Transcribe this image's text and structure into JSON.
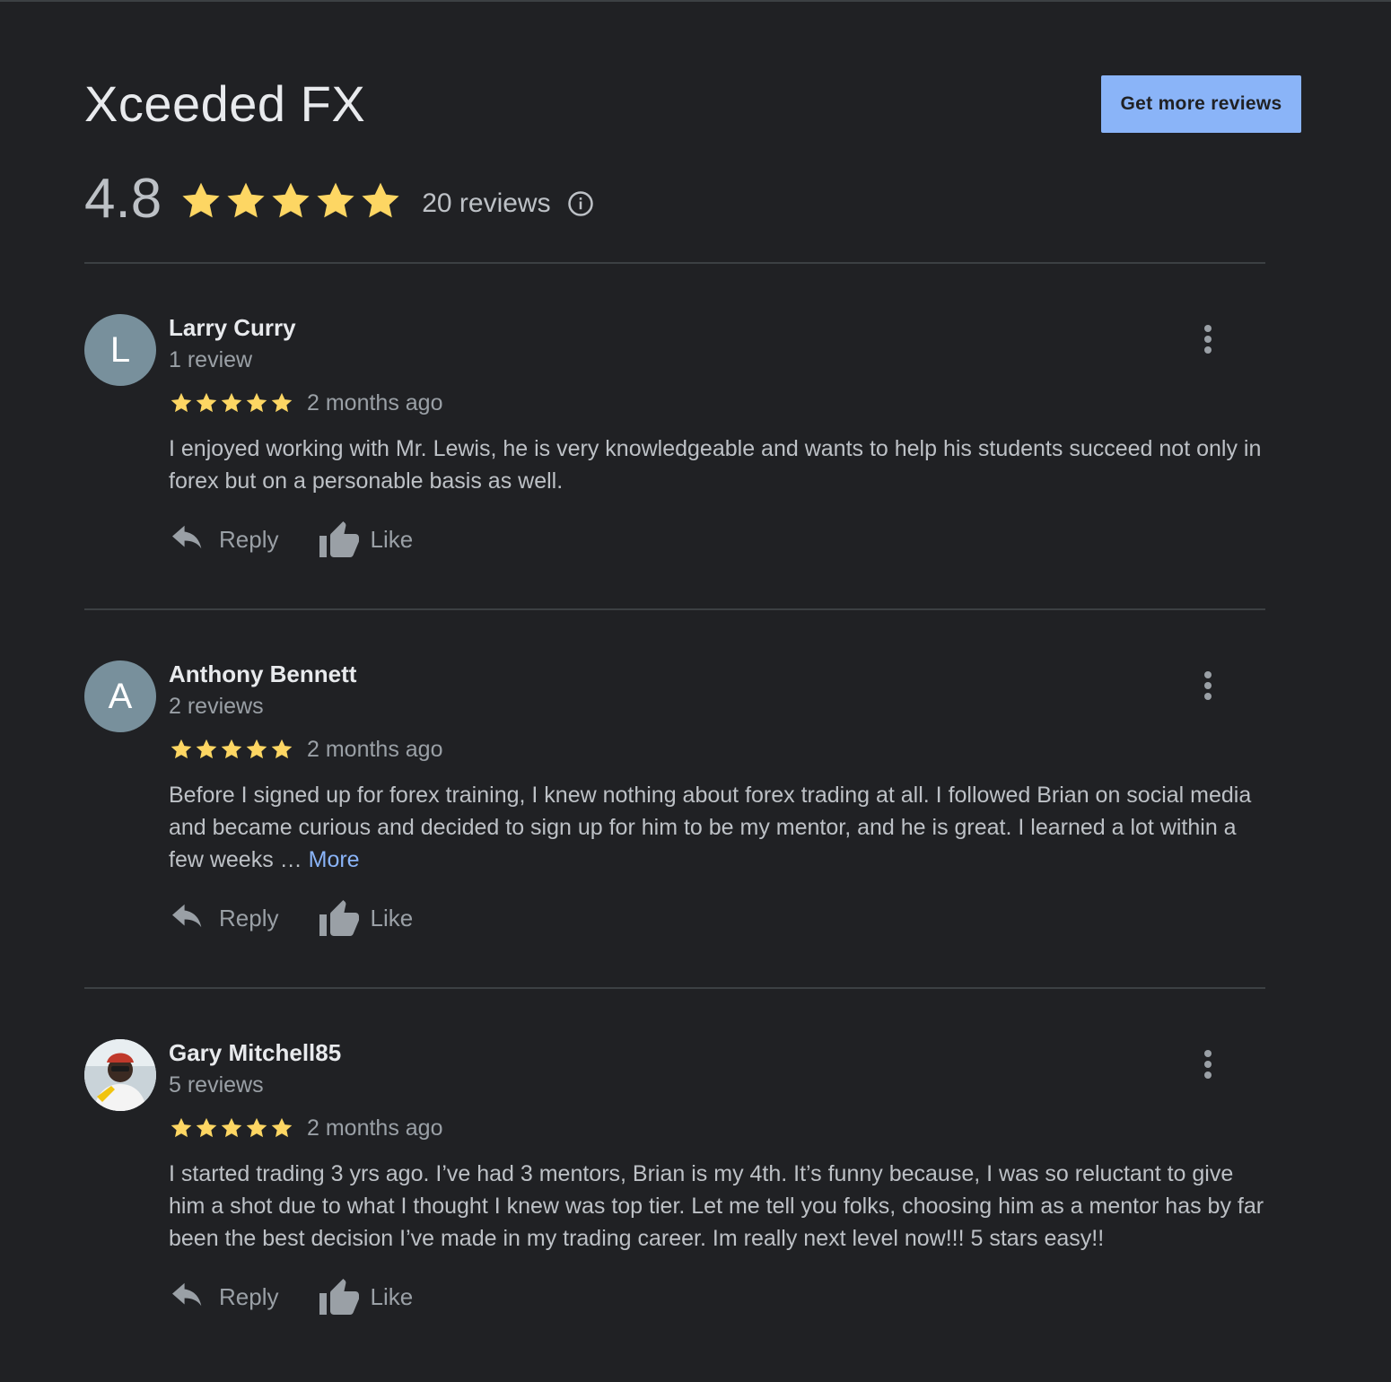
{
  "business": {
    "name": "Xceeded FX",
    "get_more_reviews_label": "Get more reviews",
    "rating": "4.8",
    "rating_stars": 5,
    "reviews_count": "20 reviews",
    "info_icon": "info-icon"
  },
  "colors": {
    "background": "#202124",
    "star": "#fdd663",
    "accent_link": "#8ab4f8",
    "button_bg": "#8ab4f8",
    "divider": "#3c4043"
  },
  "reviews": [
    {
      "avatar_letter": "L",
      "avatar_type": "letter",
      "name": "Larry Curry",
      "count": "1 review",
      "stars": 5,
      "time": "2 months ago",
      "text": "I enjoyed working with Mr. Lewis, he is very knowledgeable and wants to help his students succeed not only in forex but on a personable basis as well.",
      "more_label": "",
      "reply_label": "Reply",
      "like_label": "Like"
    },
    {
      "avatar_letter": "A",
      "avatar_type": "letter",
      "name": "Anthony Bennett",
      "count": "2 reviews",
      "stars": 5,
      "time": "2 months ago",
      "text": "Before I signed up for forex training, I knew nothing about forex trading at all. I followed Brian on social media and became curious and decided to sign up for him to be my mentor, and he is great. I learned a lot within a few weeks …",
      "more_label": "More",
      "reply_label": "Reply",
      "like_label": "Like"
    },
    {
      "avatar_letter": "",
      "avatar_type": "photo",
      "name": "Gary Mitchell85",
      "count": "5 reviews",
      "stars": 5,
      "time": "2 months ago",
      "text": "I started trading 3 yrs ago. I’ve had 3 mentors, Brian is my 4th. It’s funny because, I was so reluctant to give him a shot due to what I thought I knew was top tier. Let me tell you folks, choosing him as a mentor has by far been the best decision I’ve made in my trading career. Im really next level now!!! 5 stars easy!!",
      "more_label": "",
      "reply_label": "Reply",
      "like_label": "Like"
    }
  ]
}
